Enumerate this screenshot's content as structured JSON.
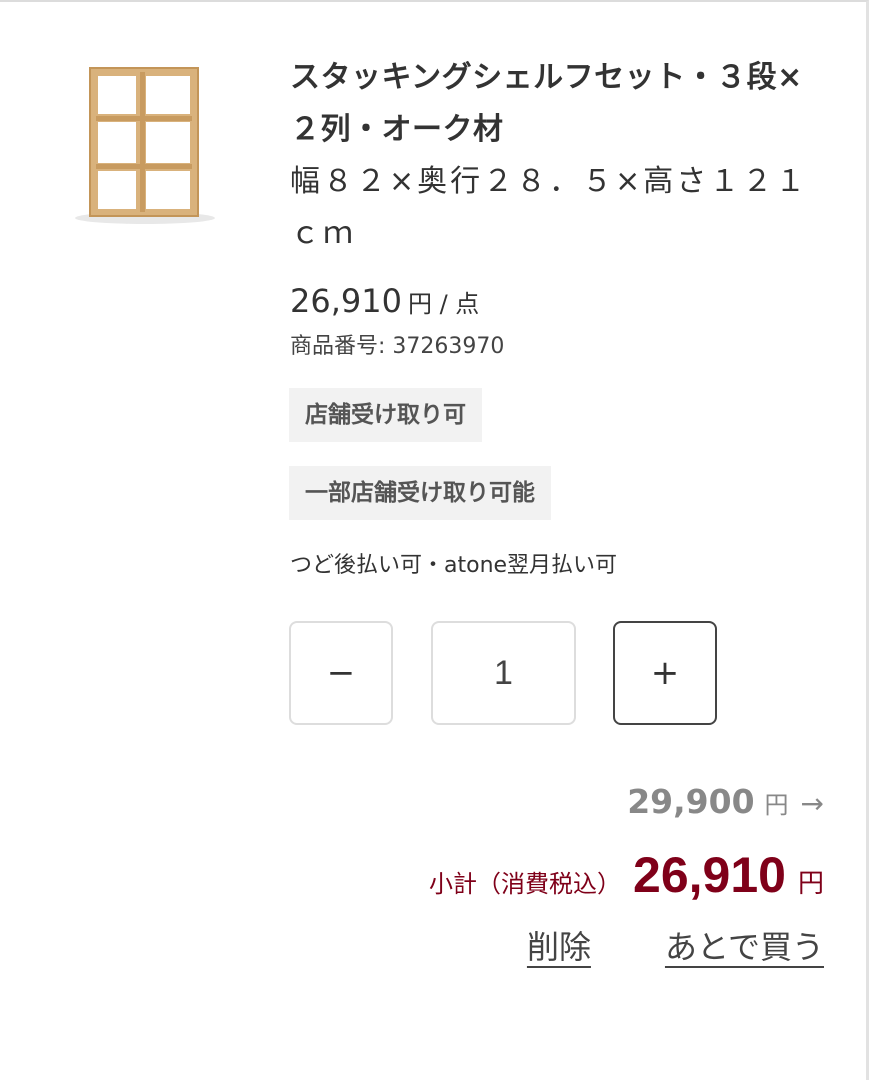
{
  "product": {
    "image_icon": "stacking-shelf-oak-image",
    "title": "スタッキングシェルフセット・３段×２列・オーク材",
    "size": "幅８２×奥行２８．５×高さ１２１ｃｍ",
    "price": "26,910",
    "price_unit": "円 / 点",
    "sku": "商品番号: 37263970"
  },
  "badges": [
    "店舗受け取り可",
    "一部店舗受け取り可能"
  ],
  "payment_note": "つど後払い可・atone翌月払い可",
  "quantity": {
    "minus_label": "−",
    "value": "1",
    "plus_label": "+"
  },
  "pricing": {
    "original_price": "29,900",
    "original_yen": "円",
    "arrow": "→",
    "subtotal_label": "小計（消費税込）",
    "subtotal_amount": "26,910",
    "subtotal_yen": "円"
  },
  "actions": {
    "delete_label": "削除",
    "later_label": "あとで買う"
  },
  "colors": {
    "accent": "#7f0019",
    "badge_bg": "#f2f2f2",
    "wood": "#d9b27c"
  }
}
